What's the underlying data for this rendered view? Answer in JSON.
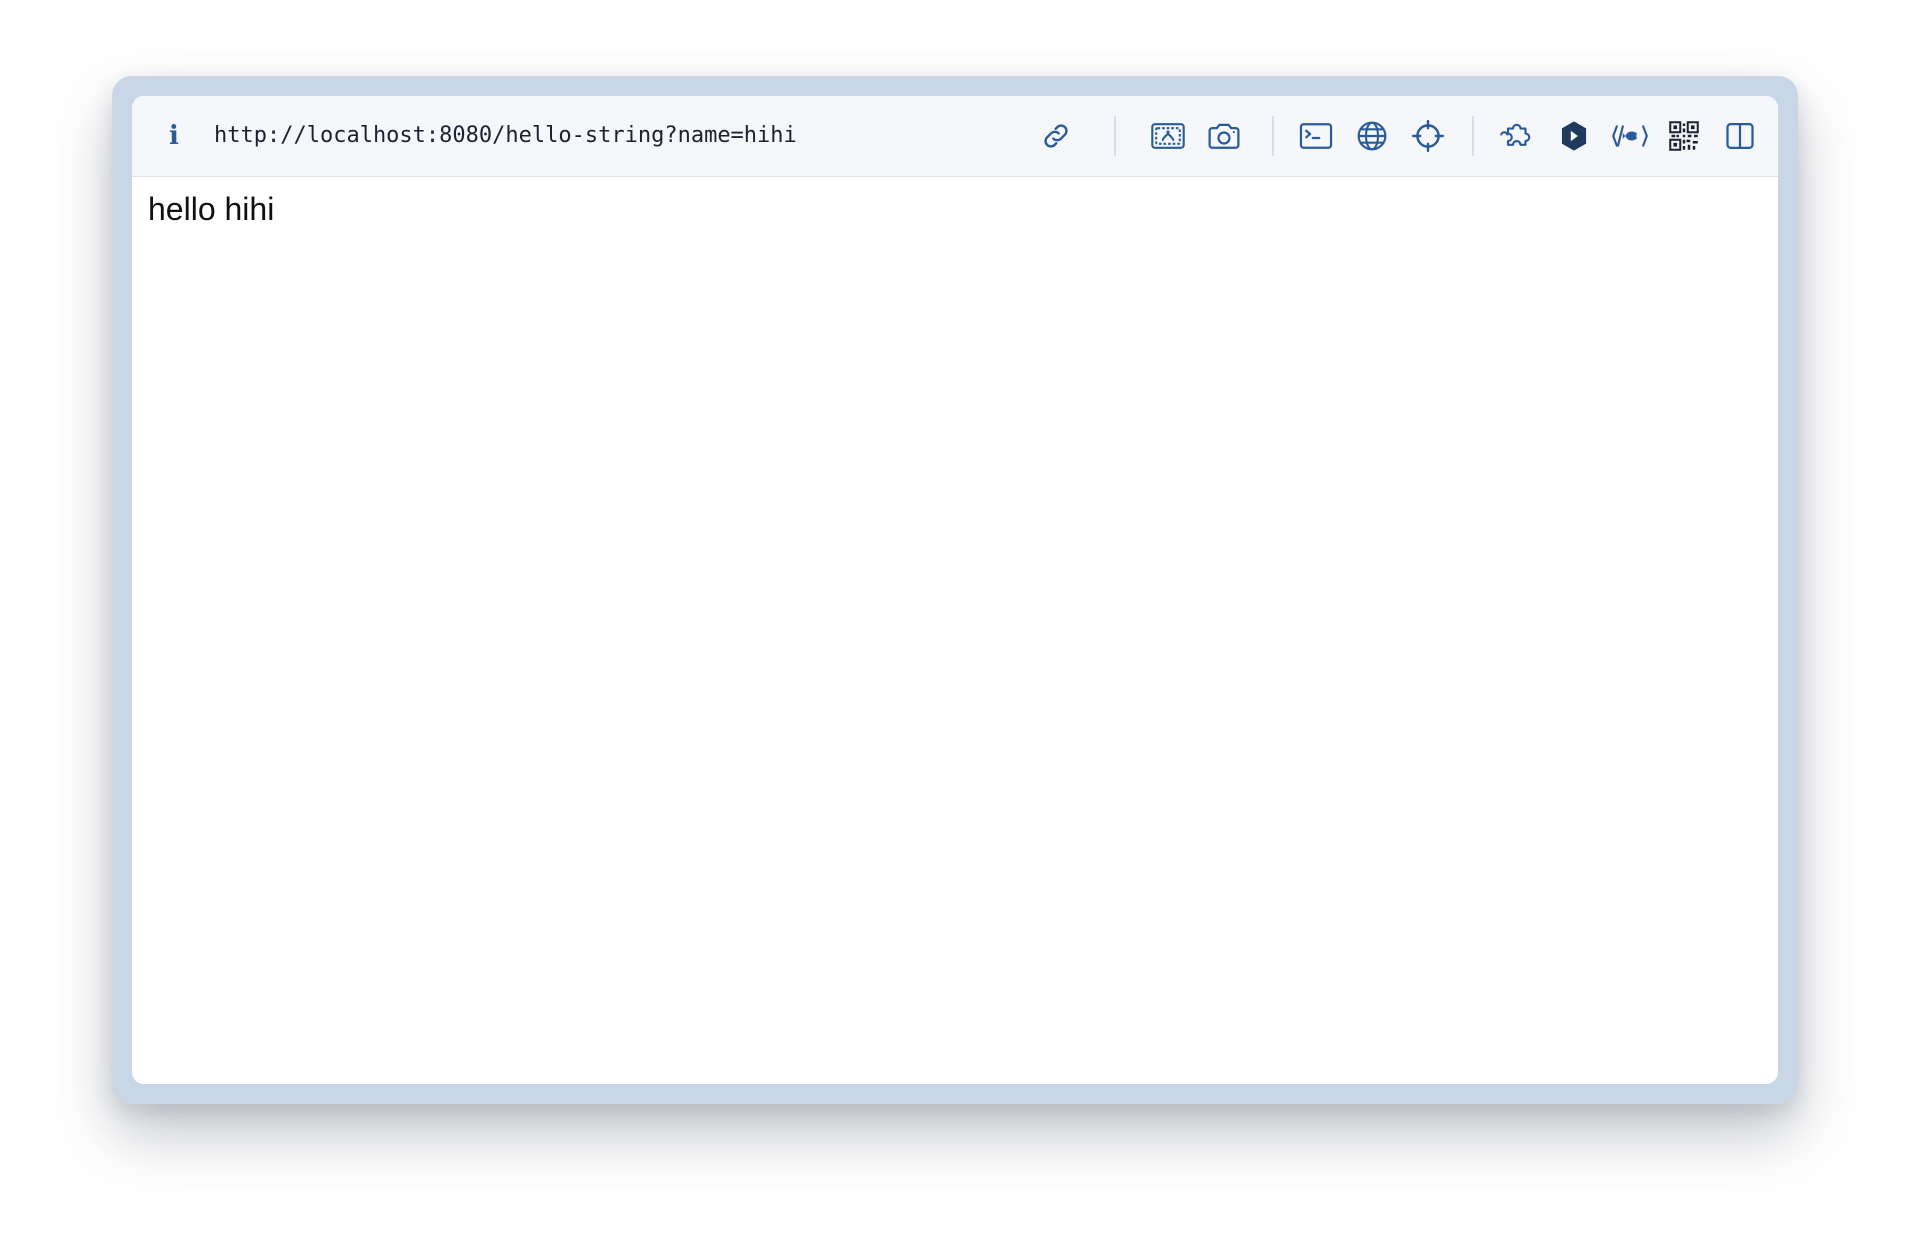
{
  "browser": {
    "url": "http://localhost:8080/hello-string?name=hihi",
    "info_icon_glyph": "i",
    "toolbar_icons": [
      "link-icon",
      "image-capture-icon",
      "camera-icon",
      "terminal-icon",
      "globe-icon",
      "crosshair-icon",
      "extension-puzzle-icon",
      "hexagon-play-icon",
      "code-fish-icon",
      "qr-code-icon",
      "split-panel-icon"
    ],
    "accent_color": "#2a5a9a",
    "frame_color": "#c9d6e6"
  },
  "page": {
    "body_text": "hello hihi"
  }
}
